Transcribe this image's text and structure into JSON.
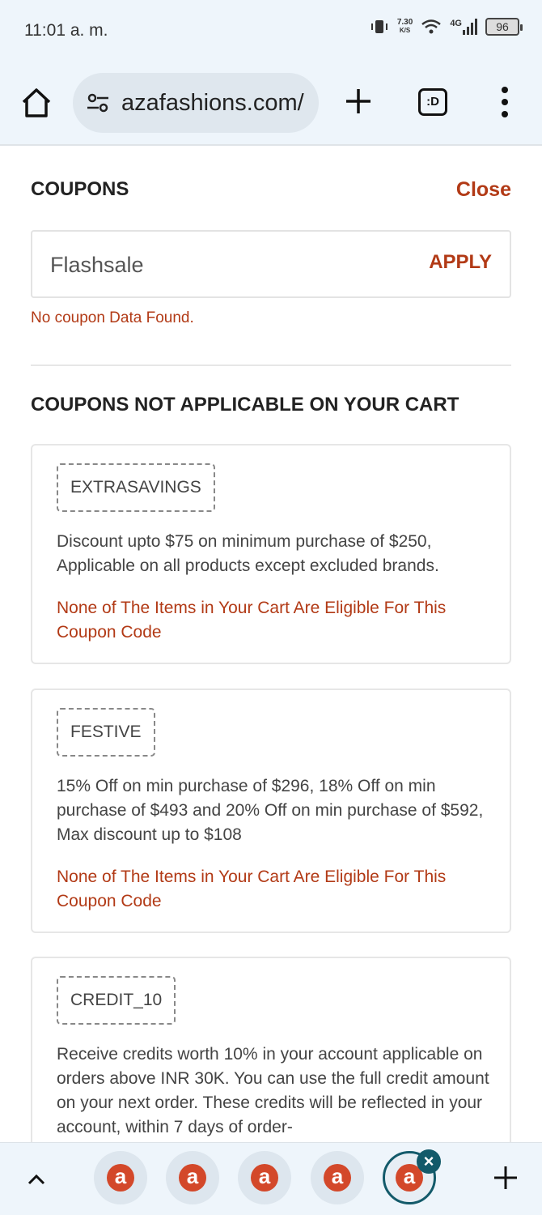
{
  "status_bar": {
    "time": "11:01 a. m.",
    "speed_value": "7.30",
    "speed_unit": "K/S",
    "network": "4G",
    "battery": "96"
  },
  "browser": {
    "url": "azafashions.com/",
    "tabs_label": ":D"
  },
  "coupons": {
    "title": "COUPONS",
    "close_label": "Close",
    "input_value": "Flashsale",
    "apply_label": "APPLY",
    "error": "No coupon Data Found.",
    "not_applicable_title": "COUPONS NOT APPLICABLE ON YOUR CART",
    "cards": [
      {
        "code": "EXTRASAVINGS",
        "description": "Discount upto $75 on minimum purchase of $250, Applicable on all products except excluded brands.",
        "note": "None of The Items in Your Cart Are Eligible For This Coupon Code"
      },
      {
        "code": "FESTIVE",
        "description": "15% Off on min purchase of $296, 18% Off on min purchase of $493 and 20% Off on min purchase of $592, Max discount up to $108",
        "note": "None of The Items in Your Cart Are Eligible For This Coupon Code"
      },
      {
        "code": "CREDIT_10",
        "description": "Receive credits worth 10% in your account applicable on orders above INR 30K. You can use the full credit amount on your next order. These credits will be reflected in your account, within 7 days of order-"
      }
    ]
  },
  "tab_bar": {
    "tab_logo": "a",
    "close_badge": "×"
  },
  "colors": {
    "accent": "#b23a16",
    "tab_active": "#135a6a"
  }
}
